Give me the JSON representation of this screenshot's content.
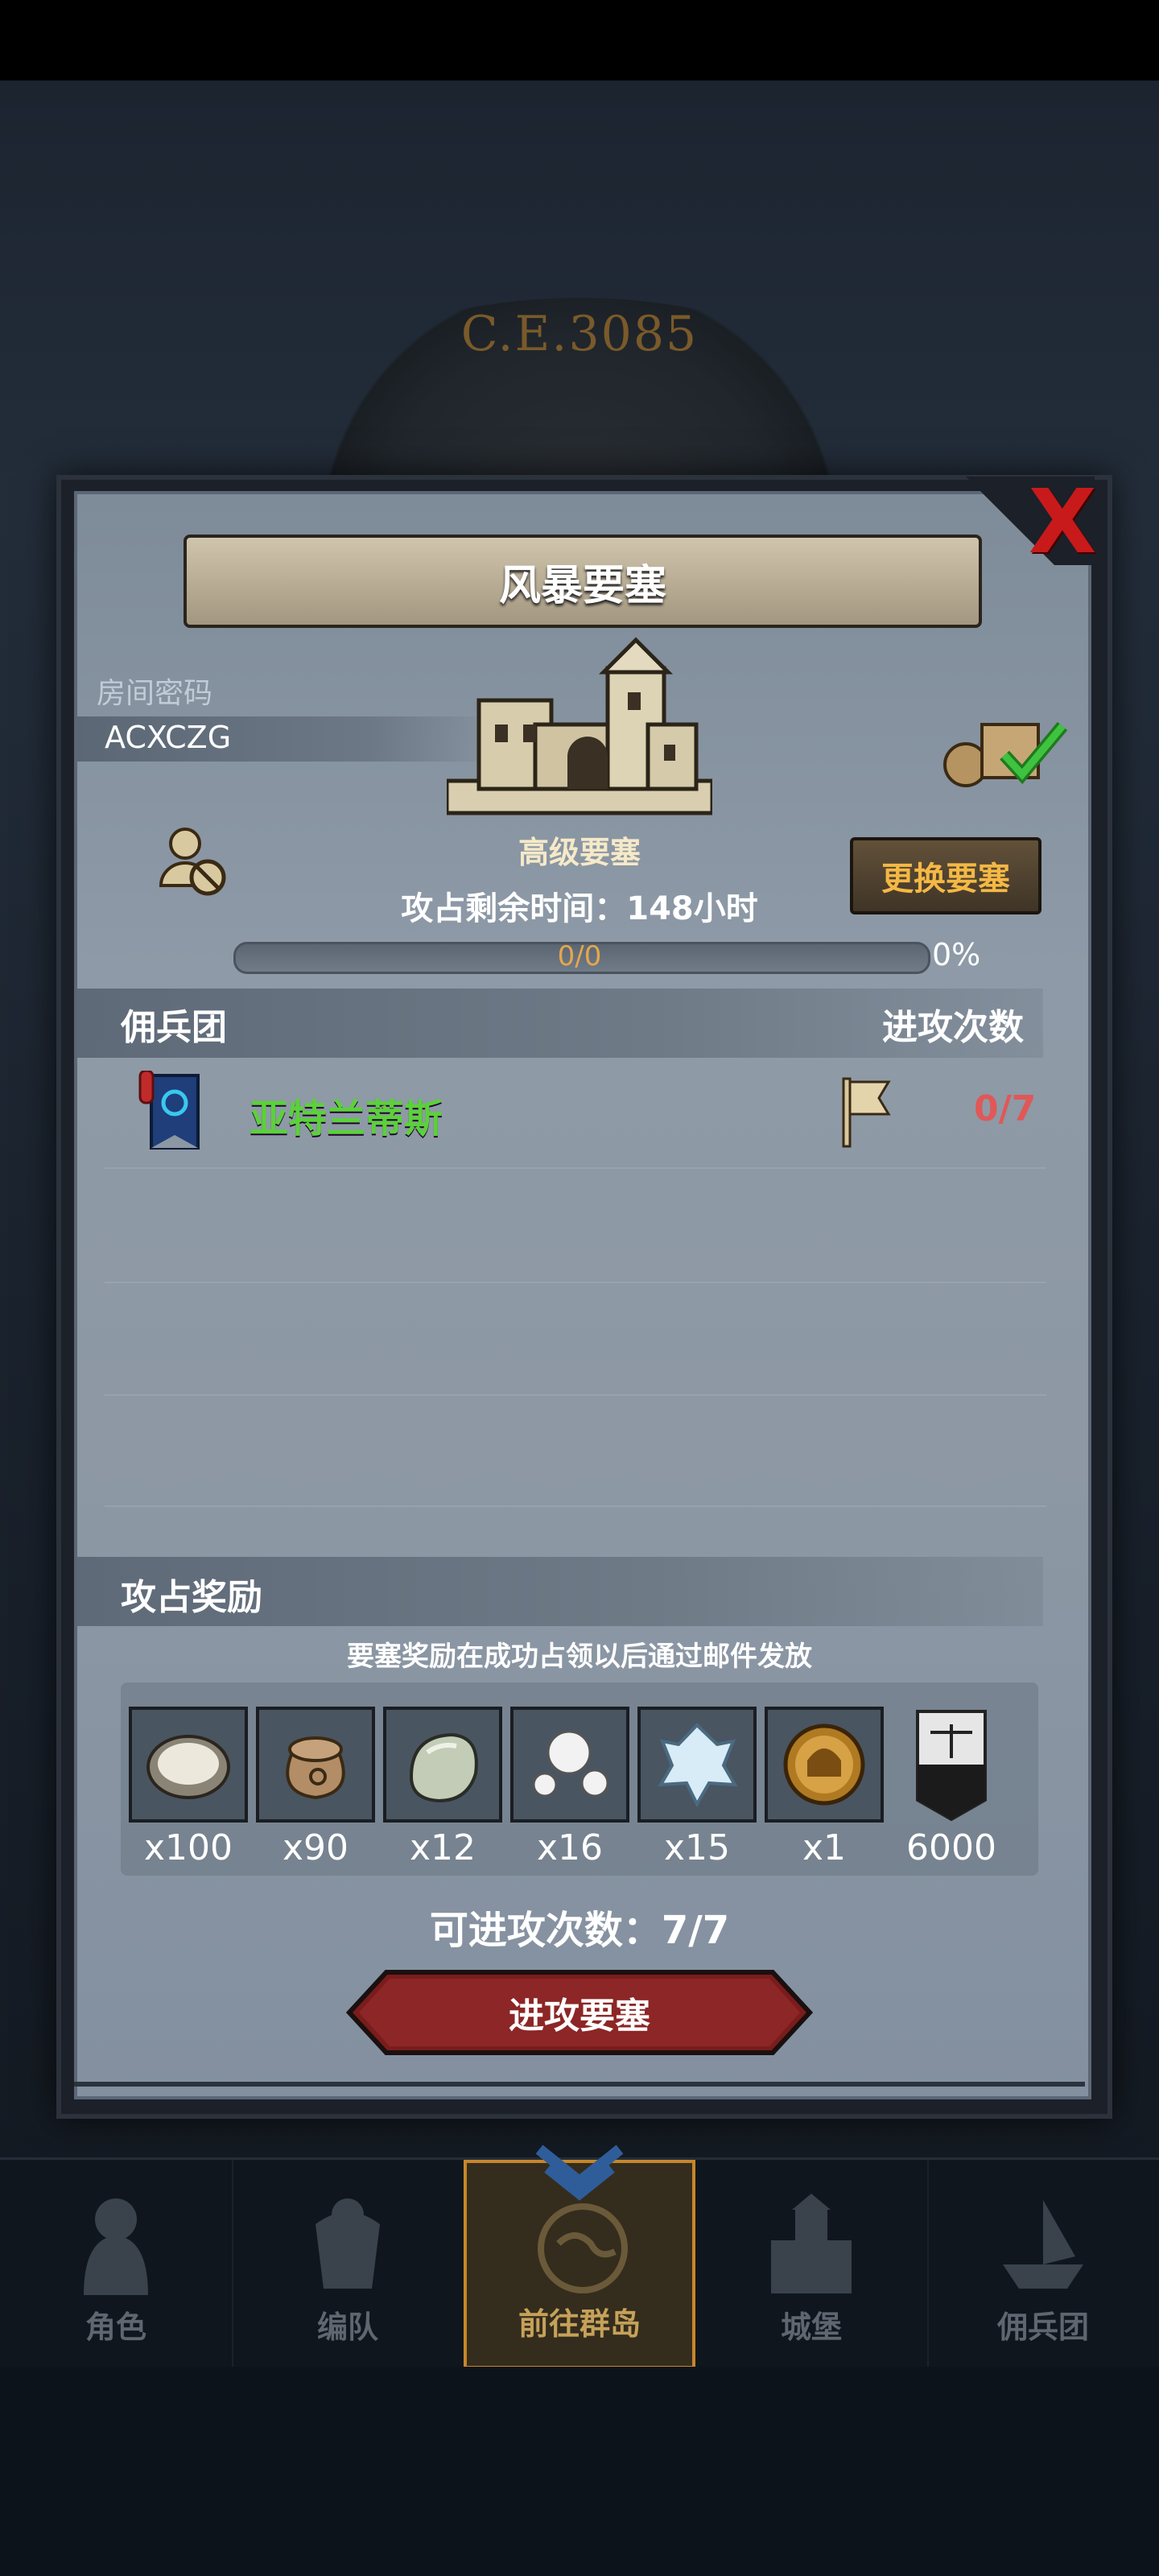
{
  "era": "C.E.3085",
  "modal": {
    "title": "风暴要塞",
    "close_label": "X",
    "room": {
      "label": "房间密码",
      "code": "ACXCZG"
    },
    "fortress": {
      "level_label": "高级要塞",
      "change_button": "更换要塞",
      "time_left": "攻占剩余时间：148小时",
      "progress_text": "0/0",
      "progress_fraction": 0,
      "progress_percent": "0%"
    },
    "mercenary_header": "佣兵团",
    "attacks_header": "进攻次数",
    "guild_rows": [
      {
        "name": "亚特兰蒂斯",
        "attacks": "0/7"
      }
    ],
    "reward_section_title": "攻占奖励",
    "reward_note": "要塞奖励在成功占领以后通过邮件发放",
    "rewards": [
      {
        "icon": "oyster-icon",
        "qty": "x100"
      },
      {
        "icon": "sack-icon",
        "qty": "x90"
      },
      {
        "icon": "stone-icon",
        "qty": "x12"
      },
      {
        "icon": "pearls-icon",
        "qty": "x16"
      },
      {
        "icon": "crystal-icon",
        "qty": "x15"
      },
      {
        "icon": "helmet-medal-icon",
        "qty": "x1"
      },
      {
        "icon": "scales-banner-icon",
        "qty": "6000"
      }
    ],
    "available_attacks": "可进攻次数：7/7",
    "attack_button": "进攻要塞"
  },
  "bottom_nav": {
    "items": [
      {
        "label": "角色",
        "icon": "knight-icon"
      },
      {
        "label": "编队",
        "icon": "armor-icon"
      },
      {
        "label": "前往群岛",
        "icon": "globe-icon",
        "active": true
      },
      {
        "label": "城堡",
        "icon": "castle-icon"
      },
      {
        "label": "佣兵团",
        "icon": "ship-icon"
      }
    ]
  },
  "colors": {
    "accent_gold": "#f4b845",
    "guild_green": "#5bd13a",
    "attack_red": "#e05858",
    "close_red": "#c81a1a"
  }
}
